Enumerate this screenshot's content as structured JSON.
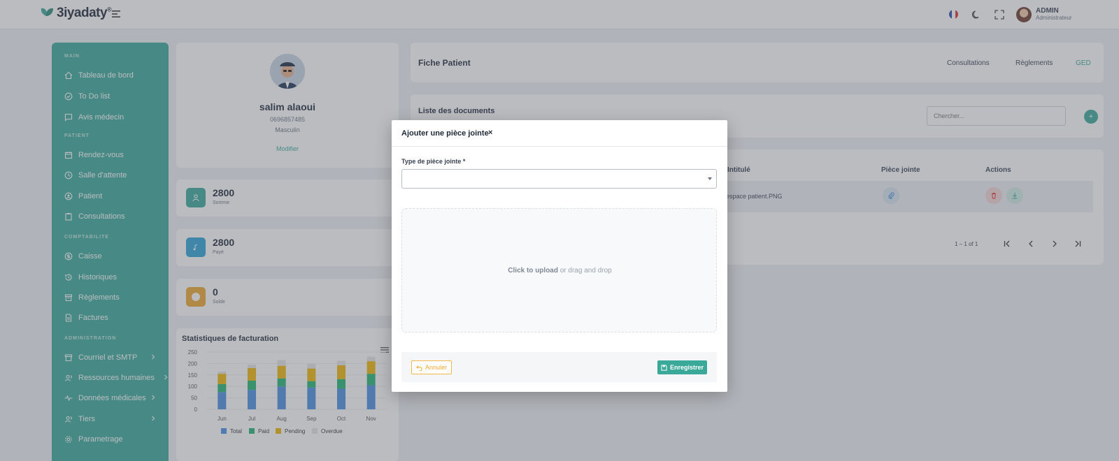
{
  "app": {
    "logo_text": "3iyadaty",
    "logo_mark": "®"
  },
  "topbar": {
    "language_icon": "flag-fr-icon",
    "theme_icon": "moon-icon",
    "fullscreen_icon": "fullscreen-icon",
    "user_name": "ADMIN",
    "user_role": "Administrateur"
  },
  "sidebar": {
    "sections": {
      "main": "MAIN",
      "patient": "PATIENT",
      "comptabilite": "COMPTABILITE",
      "administration": "ADMINISTRATION"
    },
    "items": [
      {
        "label": "Tableau de bord",
        "icon": "home-icon"
      },
      {
        "label": "To Do list",
        "icon": "check-circle-icon"
      },
      {
        "label": "Avis médecin",
        "icon": "message-icon"
      },
      {
        "label": "Rendez-vous",
        "icon": "calendar-icon"
      },
      {
        "label": "Salle d'attente",
        "icon": "clock-icon"
      },
      {
        "label": "Patient",
        "icon": "patient-icon"
      },
      {
        "label": "Consultations",
        "icon": "clipboard-icon"
      },
      {
        "label": "Caisse",
        "icon": "coin-icon"
      },
      {
        "label": "Historiques",
        "icon": "history-icon"
      },
      {
        "label": "Règlements",
        "icon": "archive-icon"
      },
      {
        "label": "Factures",
        "icon": "file-icon"
      },
      {
        "label": "Courriel et SMTP",
        "icon": "mail-box-icon"
      },
      {
        "label": "Ressources humaines",
        "icon": "users-icon"
      },
      {
        "label": "Données médicales",
        "icon": "pulse-icon"
      },
      {
        "label": "Tiers",
        "icon": "users-icon"
      },
      {
        "label": "Parametrage",
        "icon": "gear-icon"
      }
    ]
  },
  "profile": {
    "name": "salim alaoui",
    "phone": "0696857485",
    "gender": "Masculin",
    "edit_label": "Modifier"
  },
  "stats": [
    {
      "value": "2800",
      "label": "Somme",
      "color": "#3aa999"
    },
    {
      "value": "2800",
      "label": "Payé",
      "color": "#2ea3d6"
    },
    {
      "value": "0",
      "label": "Solde",
      "color": "#f0a830"
    }
  ],
  "chart": {
    "title": "Statistiques de facturation"
  },
  "chart_data": {
    "type": "bar",
    "stacked": true,
    "categories": [
      "Jun",
      "Jul",
      "Aug",
      "Sep",
      "Oct",
      "Nov"
    ],
    "series": [
      {
        "name": "Total",
        "color": "#4a90e2",
        "values": [
          75,
          85,
          100,
          95,
          90,
          105
        ]
      },
      {
        "name": "Paid",
        "color": "#22b573",
        "values": [
          35,
          40,
          35,
          28,
          42,
          50
        ]
      },
      {
        "name": "Pending",
        "color": "#f2b705",
        "values": [
          45,
          55,
          55,
          55,
          60,
          55
        ]
      },
      {
        "name": "Overdue",
        "color": "#e6e6e6",
        "values": [
          10,
          15,
          25,
          20,
          20,
          20
        ]
      }
    ],
    "yticks": [
      0,
      50,
      100,
      150,
      200,
      250
    ],
    "ylim": [
      0,
      250
    ],
    "legend_position": "bottom"
  },
  "fiche": {
    "title": "Fiche Patient",
    "tabs": [
      "Consultations",
      "Règlements",
      "GED"
    ]
  },
  "documents": {
    "title": "Liste des documents",
    "search_placeholder": "Chercher...",
    "add_label": "+"
  },
  "table": {
    "headers": {
      "intitule": "Intitulé",
      "piece": "Pièce jointe",
      "actions": "Actions"
    },
    "rows": [
      {
        "intitule": "espace patient.PNG"
      }
    ],
    "pager_text": "1 – 1 of 1"
  },
  "modal": {
    "title": "Ajouter une pièce jointe",
    "close_label": "×",
    "field_label": "Type de pièce jointe *",
    "select_value": "",
    "upload_strong": "Click to upload",
    "upload_rest": " or drag and drop",
    "cancel_label": "Annuler",
    "save_label": "Enregistrer",
    "cancel_color": "#f0a830",
    "save_color": "#3aa999"
  }
}
